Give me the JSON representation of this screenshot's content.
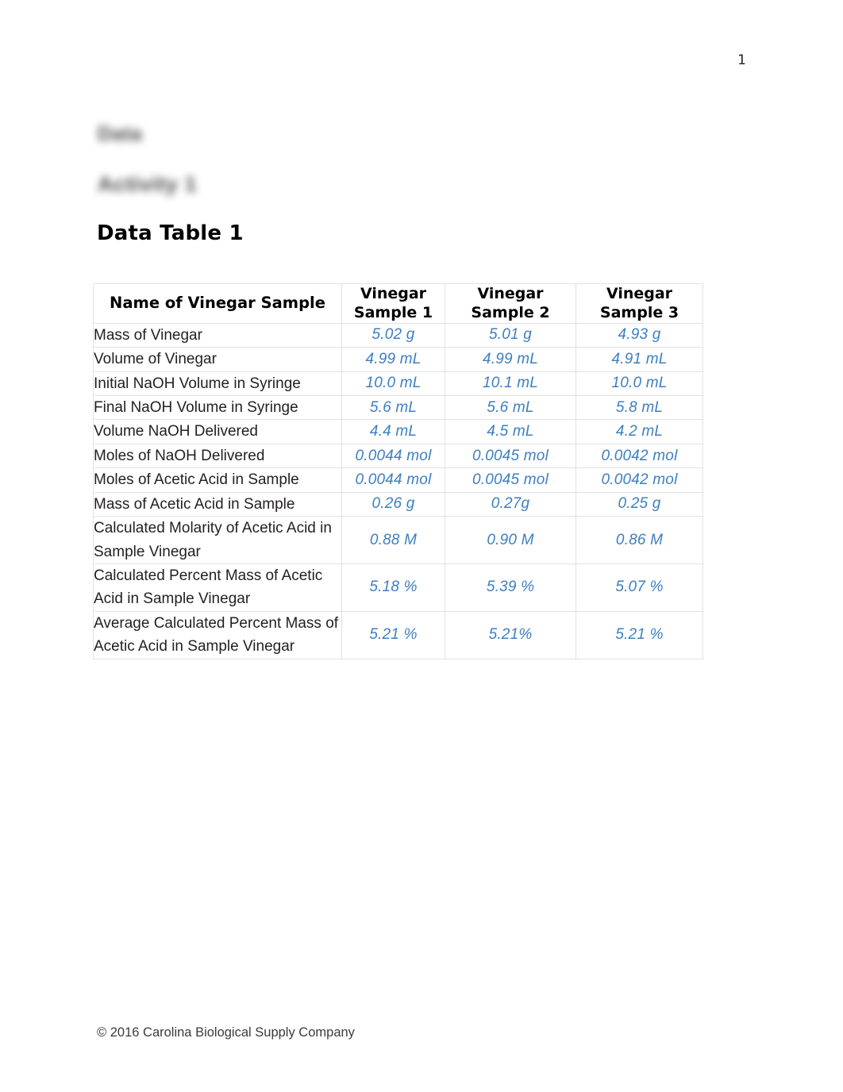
{
  "page": {
    "page_number": "1",
    "redacted_heading_1": "Data",
    "redacted_heading_2": "Activity 1",
    "section_heading": "Data Table 1",
    "footer": "© 2016 Carolina Biological Supply Company"
  },
  "table": {
    "headers": [
      "Name of Vinegar Sample",
      "Vinegar Sample 1",
      "Vinegar Sample 2",
      "Vinegar Sample 3"
    ],
    "header_lines": {
      "s1_line1": "Vinegar",
      "s1_line2": "Sample 1",
      "s2_line1": "Vinegar",
      "s2_line2": "Sample 2",
      "s3_line1": "Vinegar",
      "s3_line2": "Sample 3"
    },
    "rows": [
      {
        "label": "Mass of Vinegar",
        "s1": "5.02 g",
        "s2": "5.01 g",
        "s3": "4.93 g"
      },
      {
        "label": "Volume of Vinegar",
        "s1": "4.99 mL",
        "s2": "4.99 mL",
        "s3": "4.91 mL"
      },
      {
        "label": "Initial NaOH Volume in Syringe",
        "s1": "10.0 mL",
        "s2": "10.1 mL",
        "s3": "10.0 mL"
      },
      {
        "label": "Final NaOH Volume in Syringe",
        "s1": "5.6 mL",
        "s2": "5.6 mL",
        "s3": "5.8 mL"
      },
      {
        "label": "Volume NaOH Delivered",
        "s1": "4.4 mL",
        "s2": "4.5 mL",
        "s3": "4.2 mL"
      },
      {
        "label": "Moles of NaOH Delivered",
        "s1": "0.0044 mol",
        "s2": "0.0045 mol",
        "s3": "0.0042 mol"
      },
      {
        "label": "Moles of Acetic Acid in Sample",
        "s1": "0.0044 mol",
        "s2": "0.0045 mol",
        "s3": "0.0042 mol"
      },
      {
        "label": "Mass of Acetic Acid in Sample",
        "s1": "0.26 g",
        "s2": "0.27g",
        "s3": "0.25 g"
      },
      {
        "label": "Calculated Molarity of Acetic Acid in Sample Vinegar",
        "s1": "0.88 M",
        "s2": "0.90 M",
        "s3": "0.86 M"
      },
      {
        "label": "Calculated Percent Mass of Acetic Acid in Sample Vinegar",
        "s1": "5.18 %",
        "s2": "5.39 %",
        "s3": "5.07 %"
      },
      {
        "label": "Average Calculated Percent Mass of Acetic Acid in Sample Vinegar",
        "s1": "5.21 %",
        "s2": "5.21%",
        "s3": "5.21 %"
      }
    ]
  },
  "colors": {
    "value_blue": "#3d7fc1",
    "border_gray": "#e2e2e2",
    "text_black": "#231f20"
  }
}
